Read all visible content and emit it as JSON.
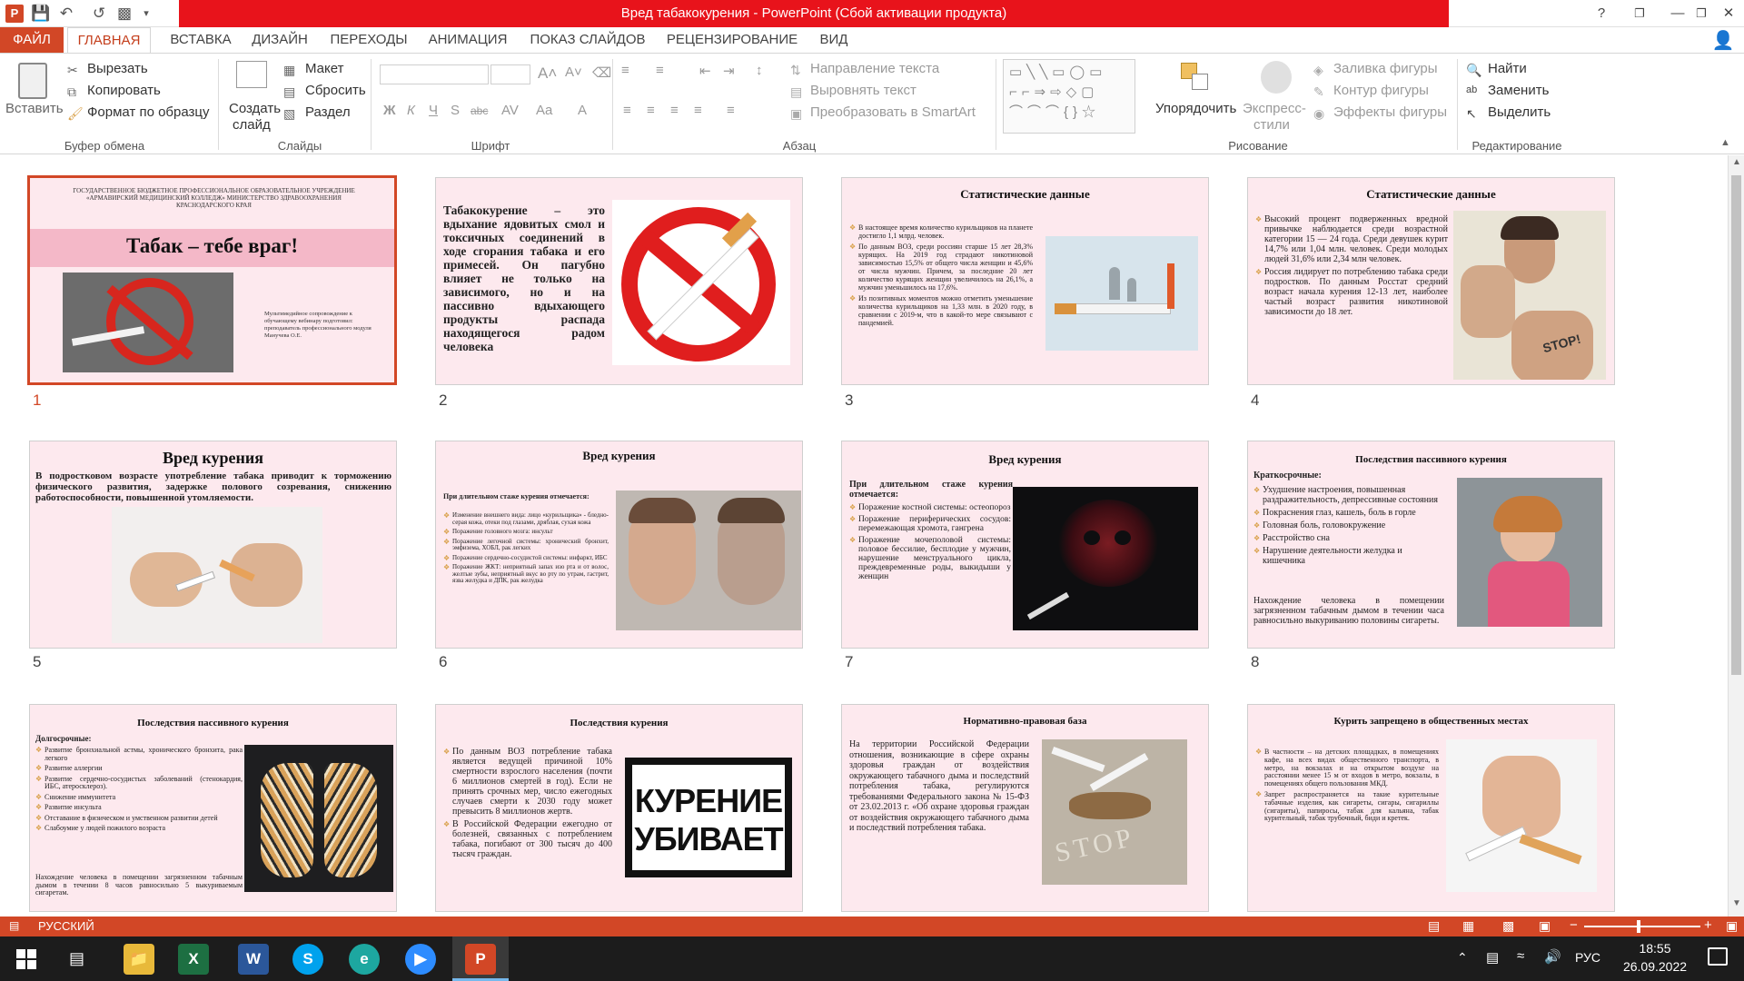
{
  "window": {
    "title": "Вред табакокурения - PowerPoint (Сбой активации продукта)",
    "controls": [
      "?",
      "❐",
      "—",
      "❐",
      "✕"
    ]
  },
  "tabs": [
    "ФАЙЛ",
    "ГЛАВНАЯ",
    "ВСТАВКА",
    "ДИЗАЙН",
    "ПЕРЕХОДЫ",
    "АНИМАЦИЯ",
    "ПОКАЗ СЛАЙДОВ",
    "РЕЦЕНЗИРОВАНИЕ",
    "ВИД"
  ],
  "ribbon": {
    "clipboard": {
      "paste": "Вставить",
      "cut": "Вырезать",
      "copy": "Копировать",
      "format": "Формат по образцу",
      "group": "Буфер обмена"
    },
    "slides": {
      "new": "Создать",
      "new2": "слайд",
      "layout": "Макет",
      "reset": "Сбросить",
      "section": "Раздел",
      "group": "Слайды"
    },
    "font": {
      "group": "Шрифт"
    },
    "paragraph": {
      "dir": "Направление текста",
      "align": "Выровнять текст",
      "smartart": "Преобразовать в SmartArt",
      "group": "Абзац"
    },
    "drawing": {
      "arrange": "Упорядочить",
      "styles": "Экспресс-",
      "styles2": "стили",
      "fill": "Заливка фигуры",
      "outline": "Контур фигуры",
      "effects": "Эффекты фигуры",
      "group": "Рисование"
    },
    "editing": {
      "find": "Найти",
      "replace": "Заменить",
      "select": "Выделить",
      "group": "Редактирование"
    }
  },
  "slides": [
    {
      "num": "1",
      "header": "ГОСУДАРСТВЕННОЕ БЮДЖЕТНОЕ ПРОФЕССИОНАЛЬНОЕ ОБРАЗОВАТЕЛЬНОЕ УЧРЕЖДЕНИЕ «АРМАВИРСКИЙ МЕДИЦИНСКИЙ КОЛЛЕДЖ» МИНИСТЕРСТВО ЗДРАВООХРАНЕНИЯ КРАСНОДАРСКОГО КРАЯ",
      "title": "Табак – тебе враг!",
      "note": "Мультимедийное сопровождение к обучающему вебинару подготовил: преподаватель профессионального модуля Манучева О.Е."
    },
    {
      "num": "2",
      "text": "Табакокурение – это вдыхание ядовитых смол и токсичных соединений в ходе сгорания табака и его примесей. Он пагубно влияет не только на зависимого, но и на пассивно вдыхающего продукты распада находящегося радом человека"
    },
    {
      "num": "3",
      "title": "Статистические данные",
      "bullets": [
        "В настоящее время количество курильщиков на планете достигло 1,1 млрд. человек.",
        "По данным ВОЗ, среди россиян старше 15 лет 28,3% курящих. На 2019 год страдают никотиновой зависимостью 15,5% от общего числа женщин и 45,6% от числа мужчин. Причем, за последние 20 лет количество курящих женщин увеличилось на 26,1%, а мужчин уменьшилось на 17,6%.",
        "Из позитивных моментов можно отметить уменьшение количества курильщиков на 1,33 млн. в 2020 году, в сравнении с 2019-м, что в какой-то мере связывают с пандемией."
      ]
    },
    {
      "num": "4",
      "title": "Статистические данные",
      "bullets": [
        "Высокий процент подверженных вредной привычке наблюдается среди возрастной категории 15 — 24 года. Среди девушек курит 14,7% или 1,04 млн. человек. Среди молодых людей 31,6% или 2,34 млн человек.",
        "Россия лидирует по потреблению табака среди подростков. По данным Росстат средний возраст начала курения 12-13 лет, наиболее частый возраст развития никотиновой зависимости до 18 лет."
      ]
    },
    {
      "num": "5",
      "title": "Вред курения",
      "text": "В подростковом возрасте употребление табака приводит к торможению физического развития, задержке полового созревания, снижению работоспособности, повышенной утомляемости."
    },
    {
      "num": "6",
      "title": "Вред курения",
      "lead": "При длительном стаже курения отмечается:",
      "bullets": [
        "Изменение внешнего вида: лицо «курильщика» - бледно-серая кожа, отеки под глазами, дряблая, сухая кожа",
        "Поражение головного мозга: инсульт",
        "Поражение легочной системы: хронический бронхит, эмфизема, ХОБЛ, рак легких",
        "Поражение сердечно-сосудистой системы: инфаркт, ИБС",
        "Поражение ЖКТ: неприятный запах изо рта и от волос, желтые зубы, неприятный вкус во рту по утрам, гастрит, язва желудка и ДПК, рак желудка"
      ]
    },
    {
      "num": "7",
      "title": "Вред курения",
      "lead": "При длительном стаже курения отмечается:",
      "bullets": [
        "Поражение костной системы: остеопороз",
        "Поражение периферических сосудов: перемежающая хромота, гангрена",
        "Поражение мочеполовой системы: половое бессилие, бесплодие у мужчин, нарушение менструального цикла, преждевременные роды, выкидыши у женщин"
      ]
    },
    {
      "num": "8",
      "title": "Последствия пассивного курения",
      "lead": "Краткосрочные:",
      "bullets": [
        "Ухудшение настроения, повышенная раздражительность, депрессивные состояния",
        "Покраснения глаз, кашель, боль в горле",
        "Головная боль, головокружение",
        "Расстройство сна",
        "Нарушение деятельности желудка и кишечника"
      ],
      "foot": "Нахождение человека в помещении загрязненном табачным дымом в течении часа равносильно выкуриванию половины сигареты."
    },
    {
      "num": "9",
      "title": "Последствия пассивного курения",
      "lead": "Долгосрочные:",
      "bullets": [
        "Развитие бронхиальной астмы, хронического бронхита, рака легкого",
        "Развитие аллергии",
        "Развитие сердечно-сосудистых заболеваний (стенокардия, ИБС, атеросклероз).",
        "Снижение иммунитета",
        "Развитие инсульта",
        "Отставание в физическом и умственном развитии детей",
        "Слабоумие у людей пожилого возраста"
      ],
      "foot": "Нахождение человека в помещении загрязненном табачным дымом в течении 8 часов равносильно 5 выкуриваемым сигаретам."
    },
    {
      "num": "10",
      "title": "Последствия курения",
      "bullets": [
        "По данным ВОЗ потребление табака является ведущей причиной 10% смертности взрослого населения (почти 6 миллионов смертей в год). Если не принять срочных мер, число ежегодных случаев смерти к 2030 году может превысить 8 миллионов жертв.",
        "В Российской Федерации ежегодно от болезней, связанных с потреблением табака, погибают от 300 тысяч до 400 тысяч граждан."
      ],
      "sign1": "КУРЕНИЕ",
      "sign2": "УБИВАЕТ"
    },
    {
      "num": "11",
      "title": "Нормативно-правовая база",
      "text": "На территории Российской Федерации отношения, возникающие в сфере охраны здоровья граждан от воздействия окружающего табачного дыма и последствий потребления табака, регулируются требованиями Федерального закона № 15-ФЗ от 23.02.2013 г. «Об охране здоровья граждан от воздействия окружающего табачного дыма и последствий потребления табака."
    },
    {
      "num": "12",
      "title": "Курить запрещено в общественных местах",
      "bullets": [
        "В частности – на детских площадках, в помещениях кафе, на всех видах общественного транспорта, в метро, на вокзалах и на открытом воздухе на расстоянии менее 15 м от входов в метро, вокзалы, в помещениях общего пользования МКД.",
        "Запрет распространяется на такие курительные табачные изделия, как сигареты, сигары, сигариллы (сигариты), папиросы, табак для кальяна, табак курительный, табак трубочный, биди и кретек."
      ]
    }
  ],
  "status": {
    "lang": "РУССКИЙ"
  },
  "taskbar": {
    "lang": "РУС",
    "time": "18:55",
    "date": "26.09.2022"
  }
}
